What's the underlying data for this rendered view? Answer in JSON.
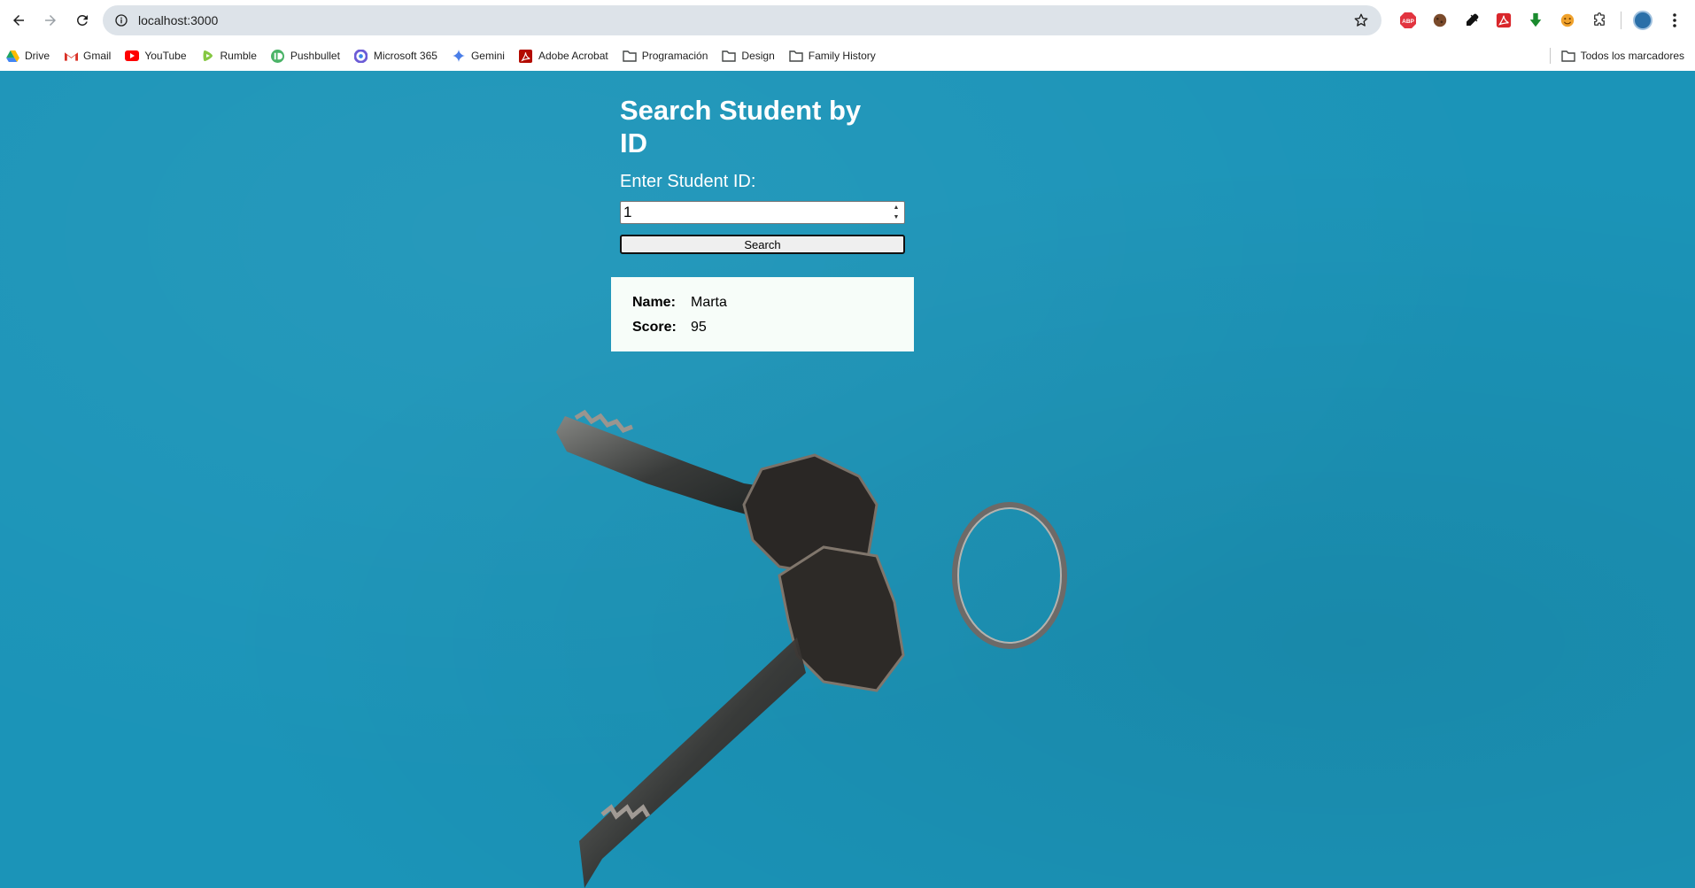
{
  "browser": {
    "url": "localhost:3000",
    "icons": {
      "back": "arrow-left-icon",
      "forward": "arrow-right-icon",
      "reload": "reload-icon",
      "site_info": "info-icon",
      "bookmark_star": "star-icon",
      "menu": "kebab-menu-icon"
    },
    "extensions": [
      {
        "name": "adblock-extension-icon",
        "label": "ABP",
        "color": "#e2343f"
      },
      {
        "name": "cookie-extension-icon",
        "label": "",
        "color": "#7a4a2b"
      },
      {
        "name": "eyedropper-extension-icon",
        "label": "",
        "color": "#111111"
      },
      {
        "name": "acrobat-extension-icon",
        "label": "",
        "color": "#d9262b"
      },
      {
        "name": "download-extension-icon",
        "label": "",
        "color": "#1a8a2e"
      },
      {
        "name": "emoji-extension-icon",
        "label": "",
        "color": "#f0a22c"
      },
      {
        "name": "puzzle-extensions-icon",
        "label": "",
        "color": "#444444"
      }
    ]
  },
  "bookmarks": [
    {
      "name": "bookmark-drive",
      "icon": "drive-icon",
      "label": "Drive",
      "color": "#1fa463"
    },
    {
      "name": "bookmark-gmail",
      "icon": "gmail-icon",
      "label": "Gmail",
      "color": "#d93025"
    },
    {
      "name": "bookmark-youtube",
      "icon": "youtube-icon",
      "label": "YouTube",
      "color": "#ff0000"
    },
    {
      "name": "bookmark-rumble",
      "icon": "rumble-icon",
      "label": "Rumble",
      "color": "#85c742"
    },
    {
      "name": "bookmark-pushbullet",
      "icon": "pushbullet-icon",
      "label": "Pushbullet",
      "color": "#4ab367"
    },
    {
      "name": "bookmark-microsoft365",
      "icon": "microsoft365-icon",
      "label": "Microsoft 365",
      "color": "#6b5bd6"
    },
    {
      "name": "bookmark-gemini",
      "icon": "gemini-icon",
      "label": "Gemini",
      "color": "#4a7ee8"
    },
    {
      "name": "bookmark-adobe-acrobat",
      "icon": "acrobat-icon",
      "label": "Adobe Acrobat",
      "color": "#b30b00"
    },
    {
      "name": "bookmark-folder-programacion",
      "icon": "folder-icon",
      "label": "Programación",
      "color": "#444746"
    },
    {
      "name": "bookmark-folder-design",
      "icon": "folder-icon",
      "label": "Design",
      "color": "#444746"
    },
    {
      "name": "bookmark-folder-family-history",
      "icon": "folder-icon",
      "label": "Family History",
      "color": "#444746"
    }
  ],
  "all_bookmarks": {
    "icon": "folder-icon",
    "label": "Todos los marcadores"
  },
  "page": {
    "background_color": "#1b94b8",
    "title": "Search Student by ID",
    "input_label": "Enter Student ID:",
    "input_value": "1",
    "search_label": "Search",
    "result": {
      "name_key": "Name:",
      "name_value": "Marta",
      "score_key": "Score:",
      "score_value": "95"
    },
    "background_image": "keys-photo"
  }
}
